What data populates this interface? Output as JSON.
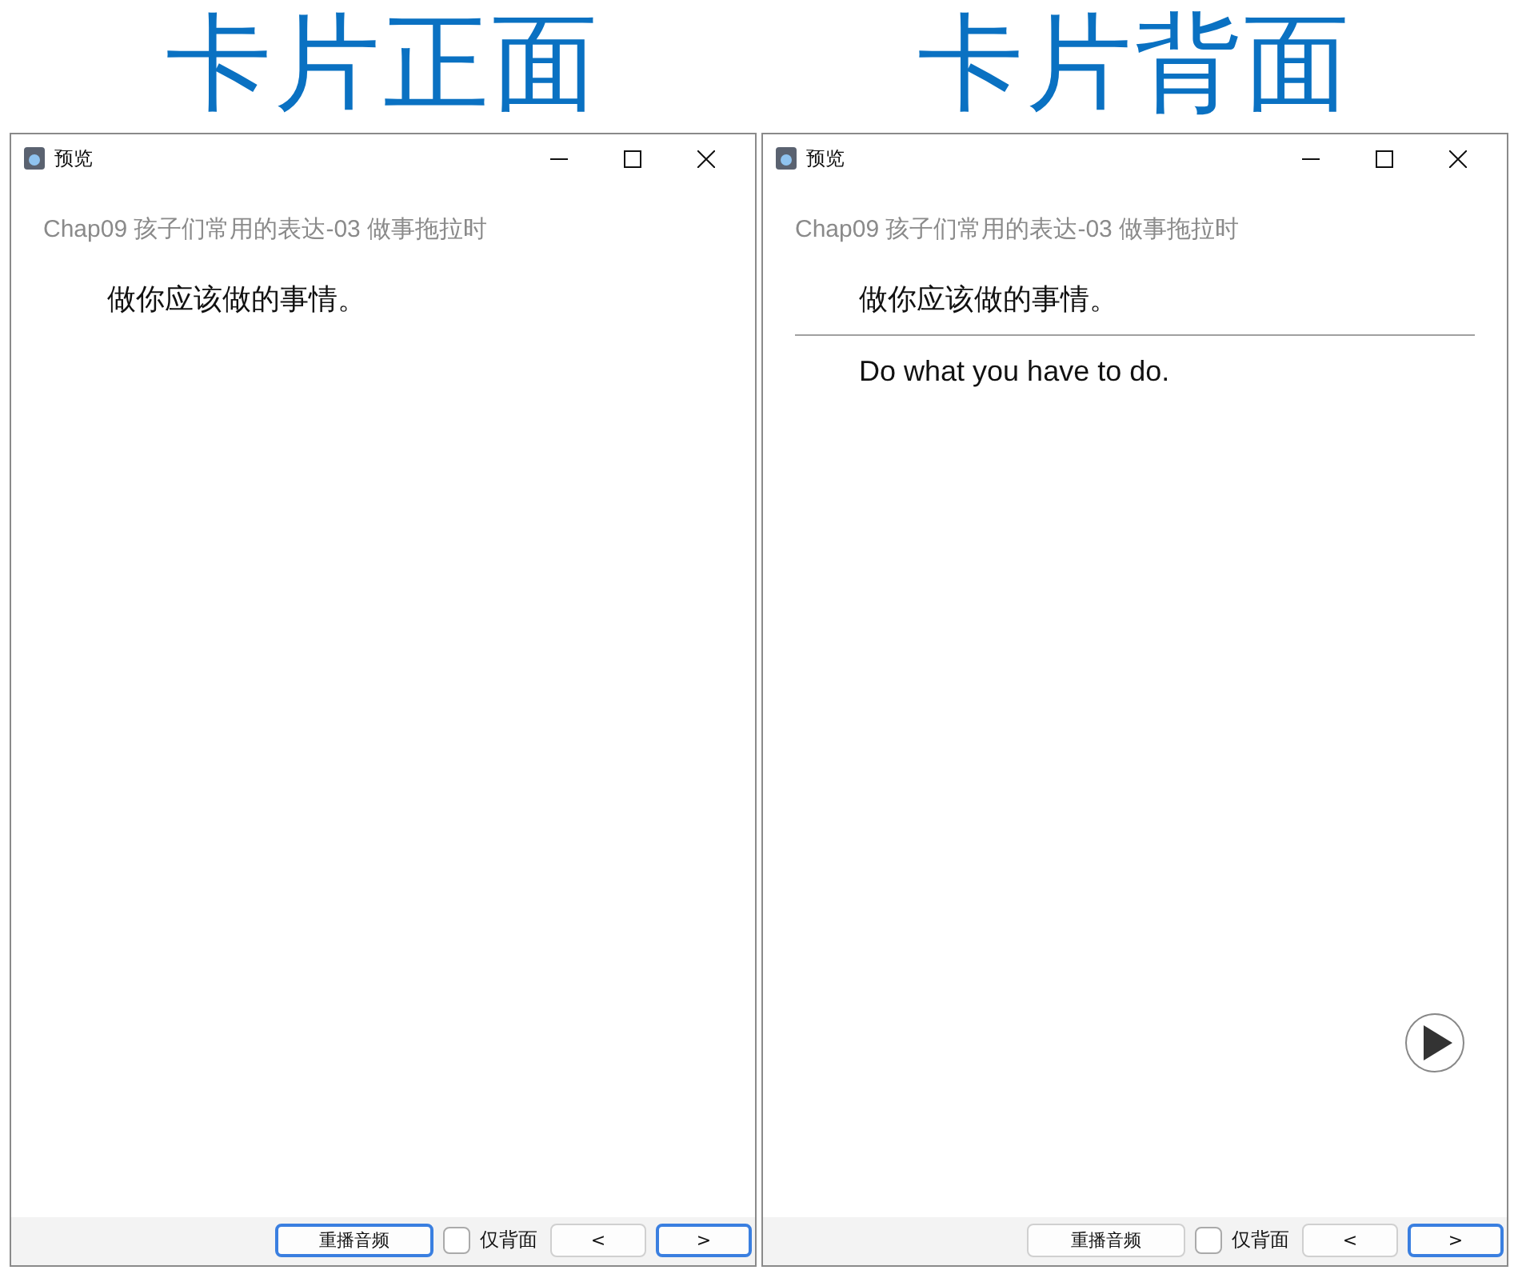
{
  "panels": [
    {
      "heading": "卡片正面",
      "window": {
        "title": "预览",
        "deck_title": "Chap09 孩子们常用的表达-03 做事拖拉时",
        "front": "做你应该做的事情。",
        "play_button": false,
        "toolbar": {
          "replay": {
            "label": "重播音频",
            "focused": true
          },
          "back_only": {
            "label": "仅背面",
            "checked": false
          },
          "prev": {
            "label": "<",
            "focused": false
          },
          "next": {
            "label": ">",
            "focused": true
          }
        }
      }
    },
    {
      "heading": "卡片背面",
      "window": {
        "title": "预览",
        "deck_title": "Chap09 孩子们常用的表达-03 做事拖拉时",
        "front": "做你应该做的事情。",
        "back": "Do what you have to do.",
        "play_button": true,
        "toolbar": {
          "replay": {
            "label": "重播音频",
            "focused": false
          },
          "back_only": {
            "label": "仅背面",
            "checked": false
          },
          "prev": {
            "label": "<",
            "focused": false
          },
          "next": {
            "label": ">",
            "focused": true
          }
        }
      }
    }
  ]
}
